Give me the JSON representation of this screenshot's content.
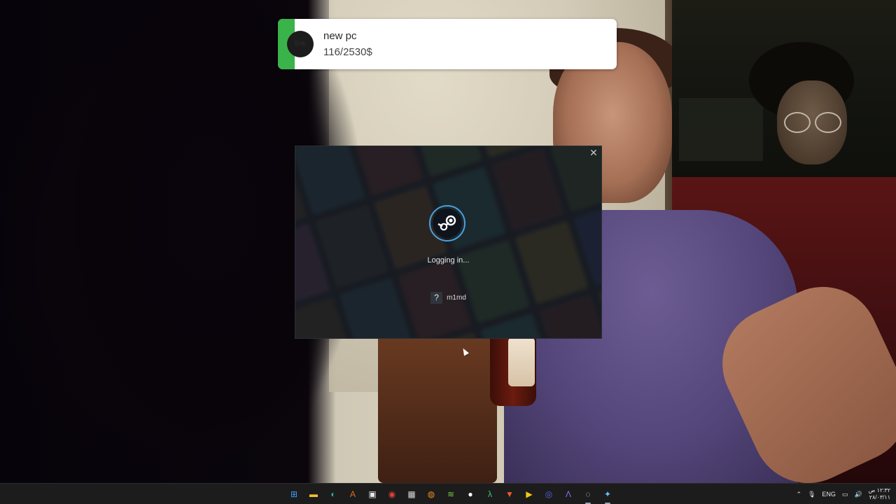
{
  "goal": {
    "title": "new pc",
    "amount": "116/2530$",
    "percent_label": "5%",
    "progress": 0.05,
    "bar_color": "#3ab44a"
  },
  "login_dialog": {
    "status": "Logging in...",
    "username": "m1md",
    "avatar_placeholder": "?",
    "close_icon": "close-icon",
    "logo_icon": "steam-logo-icon",
    "accent": "#49a0e0"
  },
  "taskbar": {
    "apps": [
      {
        "name": "start",
        "glyph": "⊞",
        "color": "#3aa0ff"
      },
      {
        "name": "file-explorer",
        "glyph": "▬",
        "color": "#f2c230"
      },
      {
        "name": "edge",
        "glyph": "◐",
        "color": "#2bb0a0"
      },
      {
        "name": "app-a",
        "glyph": "A",
        "color": "#e46a1a"
      },
      {
        "name": "store",
        "glyph": "▣",
        "color": "#e8e8e8"
      },
      {
        "name": "chrome",
        "glyph": "◉",
        "color": "#e24133"
      },
      {
        "name": "calendar",
        "glyph": "▦",
        "color": "#d9d9d9"
      },
      {
        "name": "blender",
        "glyph": "◍",
        "color": "#f08a24"
      },
      {
        "name": "app-stack",
        "glyph": "≋",
        "color": "#7cc242"
      },
      {
        "name": "app-circle",
        "glyph": "●",
        "color": "#ffffff"
      },
      {
        "name": "app-lambda",
        "glyph": "λ",
        "color": "#3fc86f"
      },
      {
        "name": "brave",
        "glyph": "▼",
        "color": "#f05a24"
      },
      {
        "name": "app-yellow",
        "glyph": "▶",
        "color": "#f5c518"
      },
      {
        "name": "discord",
        "glyph": "◎",
        "color": "#5865f2"
      },
      {
        "name": "app-triangle",
        "glyph": "Λ",
        "color": "#8a6cff"
      },
      {
        "name": "obs",
        "glyph": "◌",
        "color": "#cfcfcf"
      },
      {
        "name": "steam",
        "glyph": "✦",
        "color": "#66c0f4"
      }
    ],
    "tray": {
      "language": "ENG",
      "time": "١٢:٣٢ ص",
      "date": "٢٨/٠٣/١١"
    }
  }
}
